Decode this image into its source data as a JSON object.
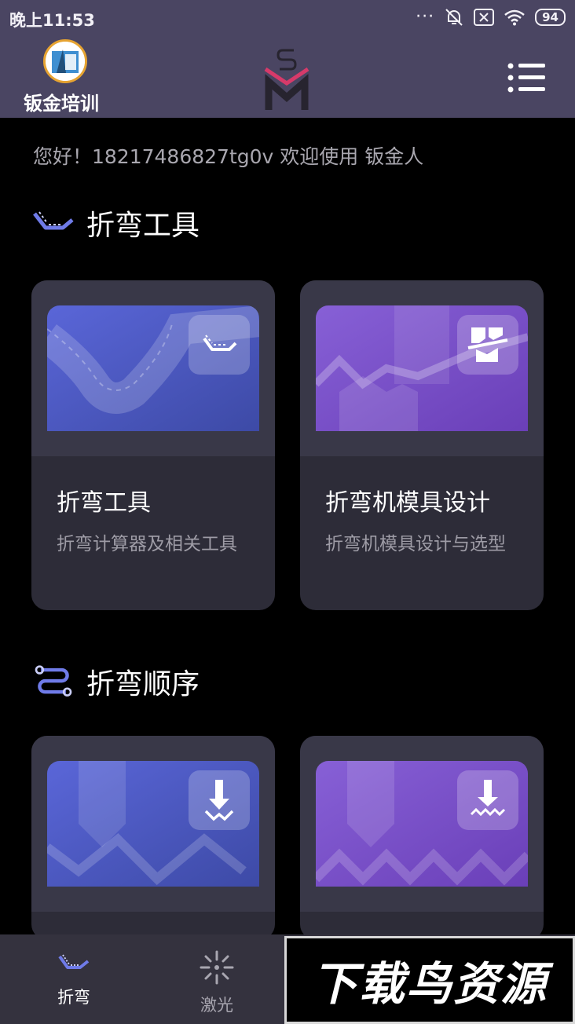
{
  "status_bar": {
    "time": "晚上11:53",
    "dots": "···",
    "battery": "94"
  },
  "header": {
    "brand": "钣金培训",
    "logo_icon": "company-logo-icon",
    "center_logo_icon": "sm-logo-icon",
    "menu_icon": "menu-icon"
  },
  "welcome_text": "您好！18217486827tg0v 欢迎使用 钣金人",
  "sections": [
    {
      "title": "折弯工具",
      "icon": "bend-tool-icon",
      "cards": [
        {
          "title": "折弯工具",
          "desc": "折弯计算器及相关工具",
          "icon": "bend-calculator-icon"
        },
        {
          "title": "折弯机模具设计",
          "desc": "折弯机模具设计与选型",
          "icon": "die-design-icon"
        }
      ]
    },
    {
      "title": "折弯顺序",
      "icon": "bend-sequence-icon",
      "cards": [
        {
          "title": "",
          "desc": "",
          "icon": "bend-down-arrow-icon"
        },
        {
          "title": "",
          "desc": "",
          "icon": "bend-wave-arrow-icon"
        }
      ]
    }
  ],
  "bottom_nav": [
    {
      "label": "折弯",
      "icon": "bend-icon",
      "active": true
    },
    {
      "label": "激光",
      "icon": "laser-icon",
      "active": false
    }
  ],
  "watermark": "下载鸟资源",
  "colors": {
    "header_bg": "#4a4562",
    "card_bg": "#2d2c38",
    "accent_blue": "#5865d6",
    "accent_purple": "#7b52c9"
  }
}
